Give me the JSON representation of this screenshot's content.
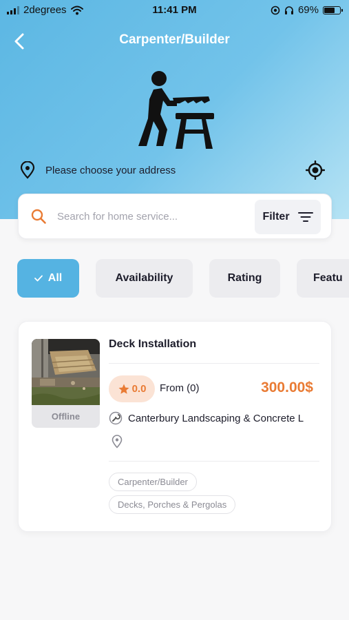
{
  "status_bar": {
    "carrier": "2degrees",
    "time": "11:41 PM",
    "battery": "69%",
    "battery_level": 0.69
  },
  "header": {
    "title": "Carpenter/Builder",
    "back_icon": "chevron-left-icon",
    "hero_icon": "carpenter-saw-icon"
  },
  "address": {
    "text": "Please choose your address",
    "pin_icon": "map-pin-icon",
    "locate_icon": "crosshair-icon"
  },
  "search": {
    "placeholder": "Search for home service...",
    "value": "",
    "icon": "search-icon",
    "filter_label": "Filter",
    "filter_icon": "filter-lines-icon"
  },
  "filters": [
    {
      "label": "All",
      "active": true
    },
    {
      "label": "Availability",
      "active": false
    },
    {
      "label": "Rating",
      "active": false
    },
    {
      "label": "Featu",
      "active": false
    }
  ],
  "listing": {
    "title": "Deck Installation",
    "status": "Offline",
    "rating": "0.0",
    "from_text": "From (0)",
    "price": "300.00$",
    "business": "Canterbury Landscaping & Concrete L",
    "tags": [
      "Carpenter/Builder",
      "Decks, Porches & Pergolas"
    ]
  },
  "colors": {
    "accent_blue": "#55b3e2",
    "accent_orange": "#e97b34",
    "rating_bg": "#fbe3d5"
  }
}
